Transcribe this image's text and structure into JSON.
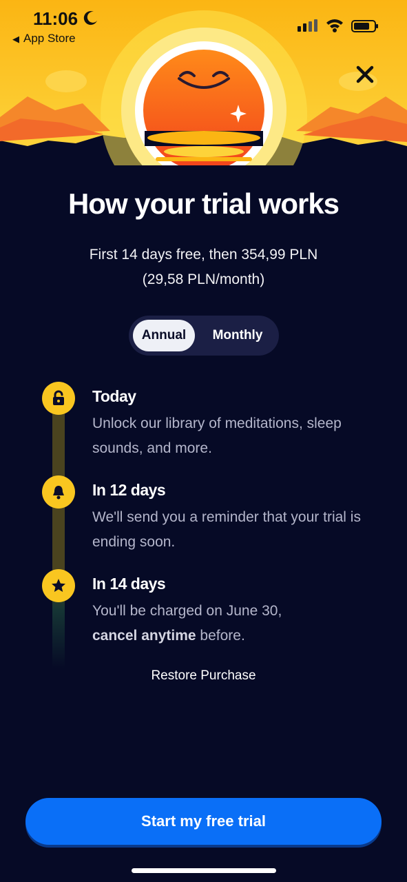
{
  "status_bar": {
    "time": "11:06",
    "back_label": "App Store"
  },
  "hero": {
    "title": "How your trial works"
  },
  "pricing": {
    "line1": "First 14 days free, then 354,99 PLN",
    "line2": "(29,58 PLN/month)"
  },
  "plan_toggle": {
    "selected": "Annual",
    "options": [
      "Annual",
      "Monthly"
    ]
  },
  "timeline": [
    {
      "heading": "Today",
      "body": "Unlock our library of meditations, sleep sounds, and more.",
      "icon": "lock-icon"
    },
    {
      "heading": "In 12 days",
      "body": "We'll send you a reminder that your trial is ending soon.",
      "icon": "bell-icon"
    },
    {
      "heading": "In 14 days",
      "body_bold": "cancel anytime",
      "body_prefix": "You'll be charged on June 30,",
      "body_suffix": " before.",
      "icon": "star-icon"
    }
  ],
  "restore_label": "Restore Purchase",
  "cta_label": "Start my free trial",
  "colors": {
    "background": "#060a26",
    "accent": "#f9c620",
    "cta": "#0a6ff7"
  }
}
